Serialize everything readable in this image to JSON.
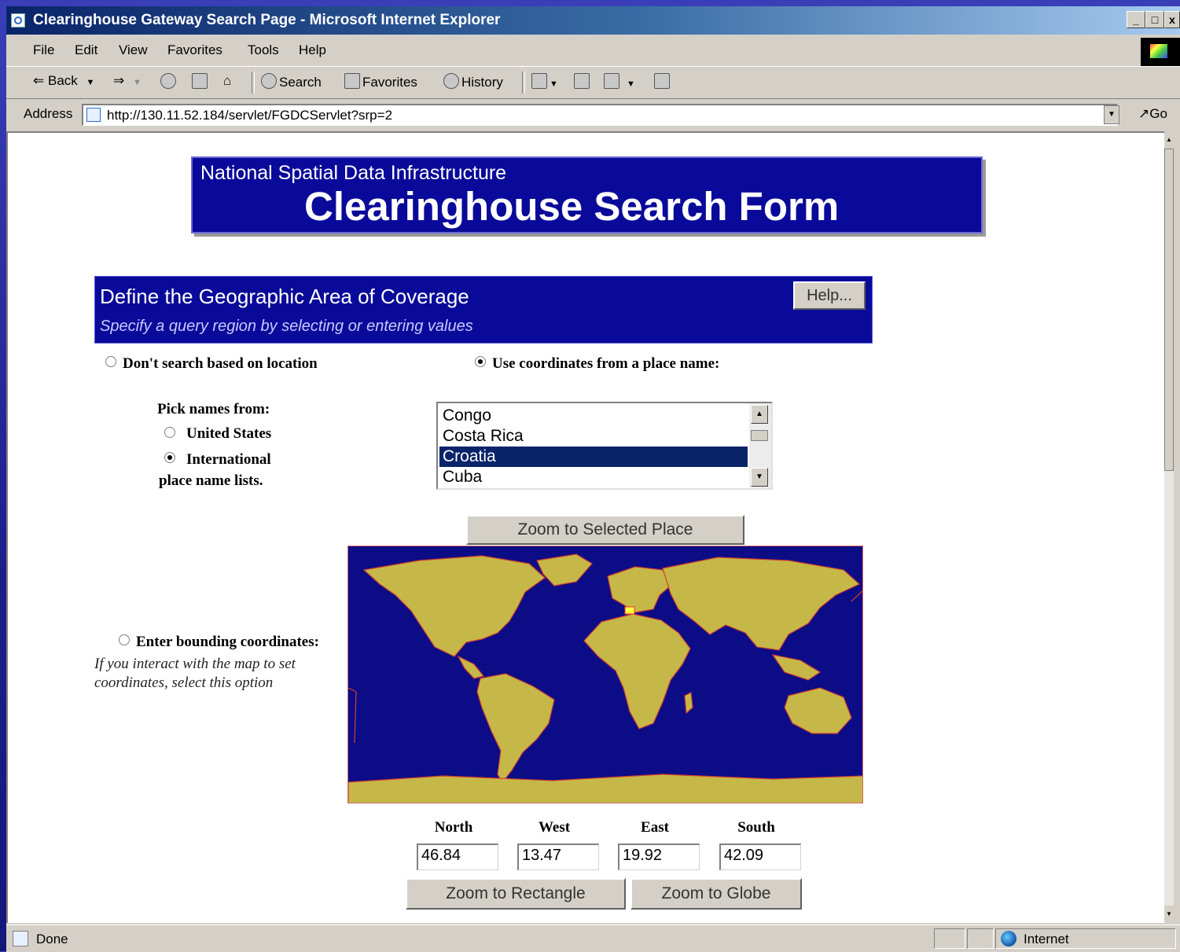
{
  "window": {
    "title": "Clearinghouse Gateway Search Page - Microsoft Internet Explorer",
    "caption_min": "_",
    "caption_max": "□",
    "caption_close": "x"
  },
  "menu": [
    "File",
    "Edit",
    "View",
    "Favorites",
    "Tools",
    "Help"
  ],
  "toolbar": {
    "back": "Back",
    "search": "Search",
    "favorites": "Favorites",
    "history": "History"
  },
  "address": {
    "label": "Address",
    "url": "http://130.11.52.184/servlet/FGDCServlet?srp=2",
    "go": "Go"
  },
  "banner": {
    "subtitle": "National Spatial Data Infrastructure",
    "title": "Clearinghouse Search Form"
  },
  "section": {
    "title": "Define the Geographic Area of Coverage",
    "subtitle": "Specify a query region by selecting or entering values",
    "help": "Help..."
  },
  "location": {
    "no_location": "Don't search based on location",
    "use_place": "Use coordinates from a place name:",
    "pick_from": "Pick names from:",
    "united_states": "United States",
    "international": "International",
    "lists_suffix": "place name lists.",
    "selected_mode": "use_place",
    "selected_list": "international"
  },
  "places": {
    "items": [
      "Congo",
      "Costa Rica",
      "Croatia",
      "Cuba"
    ],
    "selected": "Croatia"
  },
  "zoom_place_button": "Zoom to Selected Place",
  "bounding": {
    "label": "Enter bounding coordinates:",
    "hint_line1": "If you interact with the map to set",
    "hint_line2": "coordinates, select this option"
  },
  "coords": {
    "north_label": "North",
    "north": "46.84",
    "west_label": "West",
    "west": "13.47",
    "east_label": "East",
    "east": "19.92",
    "south_label": "South",
    "south": "42.09"
  },
  "zoom_rect_button": "Zoom to Rectangle",
  "zoom_globe_button": "Zoom to Globe",
  "status": {
    "text": "Done",
    "zone": "Internet"
  },
  "colors": {
    "banner_bg": "#0a0a9a",
    "selection": "#0a246a",
    "map_ocean": "#0c0c86",
    "map_land": "#c6b848"
  }
}
